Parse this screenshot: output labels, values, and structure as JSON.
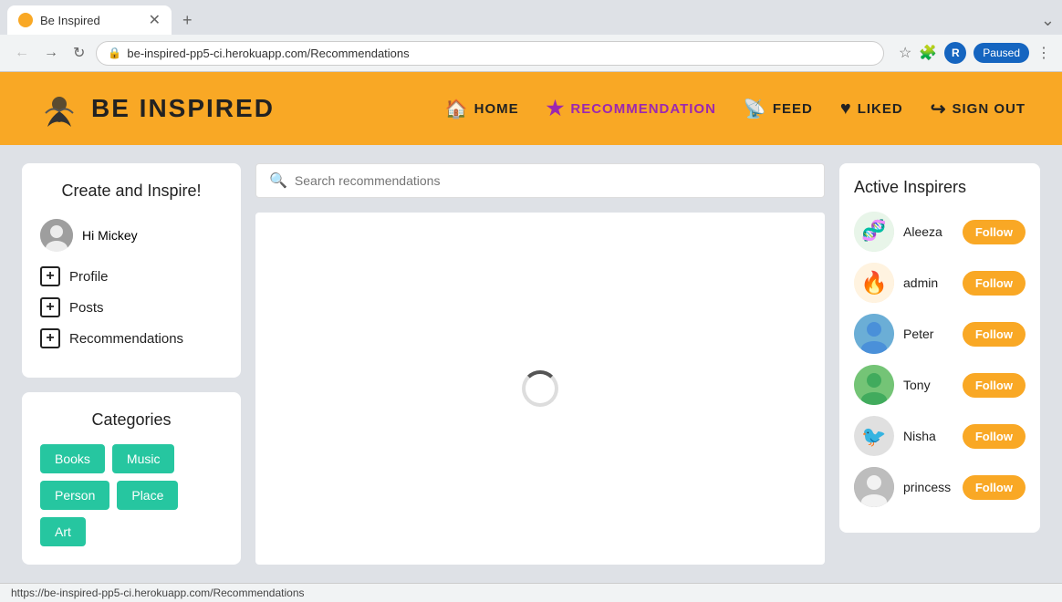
{
  "browser": {
    "tab_title": "Be Inspired",
    "url": "be-inspired-pp5-ci.herokuapp.com/Recommendations",
    "status_bar_text": "https://be-inspired-pp5-ci.herokuapp.com/Recommendations",
    "profile_initial": "R",
    "paused_label": "Paused"
  },
  "header": {
    "logo_text": "BE INSPIRED",
    "nav": [
      {
        "id": "home",
        "label": "HOME",
        "icon": "🏠",
        "active": false
      },
      {
        "id": "recommendation",
        "label": "RECOMMENDATION",
        "icon": "★",
        "active": true
      },
      {
        "id": "feed",
        "label": "FEED",
        "icon": "📡",
        "active": false
      },
      {
        "id": "liked",
        "label": "LIKED",
        "icon": "♥",
        "active": false
      },
      {
        "id": "signout",
        "label": "SIGN OUT",
        "icon": "↪",
        "active": false
      }
    ]
  },
  "sidebar": {
    "create_title": "Create and Inspire!",
    "user_greeting": "Hi Mickey",
    "links": [
      {
        "id": "profile",
        "label": "Profile"
      },
      {
        "id": "posts",
        "label": "Posts"
      },
      {
        "id": "recommendations",
        "label": "Recommendations"
      }
    ],
    "categories_title": "Categories",
    "categories": [
      "Books",
      "Music",
      "Person",
      "Place",
      "Art"
    ]
  },
  "search": {
    "placeholder": "Search recommendations"
  },
  "inspirers": {
    "title": "Active Inspirers",
    "follow_label": "Follow",
    "list": [
      {
        "id": "aleeza",
        "name": "Aleeza",
        "avatar_type": "dna"
      },
      {
        "id": "admin",
        "name": "admin",
        "avatar_type": "flame"
      },
      {
        "id": "peter",
        "name": "Peter",
        "avatar_type": "photo1"
      },
      {
        "id": "tony",
        "name": "Tony",
        "avatar_type": "photo2"
      },
      {
        "id": "nisha",
        "name": "Nisha",
        "avatar_type": "photo3"
      },
      {
        "id": "princess",
        "name": "princess",
        "avatar_type": "person"
      }
    ]
  }
}
